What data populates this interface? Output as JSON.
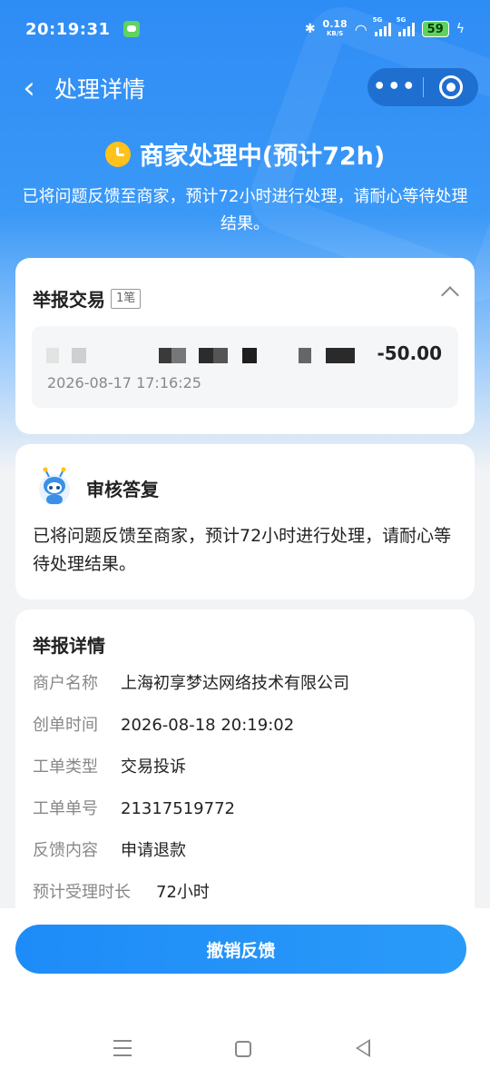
{
  "status_bar": {
    "time": "20:19:31",
    "net_speed_value": "0.18",
    "net_speed_unit": "KB/S",
    "signal_tag_1": "5G",
    "signal_tag_2": "5G",
    "battery": "59"
  },
  "nav": {
    "title": "处理详情",
    "more_label": "•••"
  },
  "status": {
    "title": "商家处理中(预计72h)",
    "description": "已将问题反馈至商家，预计72小时进行处理，请耐心等待处理结果。"
  },
  "trade": {
    "title": "举报交易",
    "count": "1笔",
    "item": {
      "amount": "-50.00",
      "time": "2026-08-17 17:16:25"
    }
  },
  "review": {
    "title": "审核答复",
    "text": "已将问题反馈至商家，预计72小时进行处理，请耐心等待处理结果。"
  },
  "detail": {
    "title": "举报详情",
    "rows": [
      {
        "label": "商户名称",
        "value": "上海初享梦达网络技术有限公司"
      },
      {
        "label": "创单时间",
        "value": "2026-08-18 20:19:02"
      },
      {
        "label": "工单类型",
        "value": "交易投诉"
      },
      {
        "label": "工单单号",
        "value": "21317519772"
      },
      {
        "label": "反馈内容",
        "value": "申请退款"
      },
      {
        "label": "预计受理时长",
        "value": "72小时"
      }
    ]
  },
  "bottom": {
    "cancel_label": "撤销反馈"
  },
  "colors": {
    "primary": "#1e8cf8",
    "header_blue": "#2e8cf5",
    "clock_yellow": "#ffc21a",
    "battery_green": "#5fd35f"
  }
}
